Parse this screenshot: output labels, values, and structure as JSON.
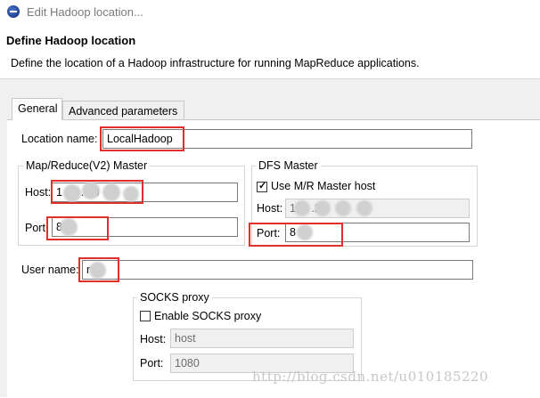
{
  "window": {
    "title": "Edit Hadoop location..."
  },
  "header": {
    "title": "Define Hadoop location",
    "description": "Define the location of a Hadoop infrastructure for running MapReduce applications."
  },
  "tabs": [
    {
      "label": "General",
      "selected": true
    },
    {
      "label": "Advanced parameters",
      "selected": false
    }
  ],
  "general": {
    "location_name_label": "Location name:",
    "location_name_value": "LocalHadoop",
    "mapreduce_group": {
      "label": "Map/Reduce(V2) Master",
      "host_label": "Host:",
      "host_value": "1 .... .. .0",
      "port_label": "Port:",
      "port_value": "8  0"
    },
    "dfs_group": {
      "label": "DFS Master",
      "use_mr_host_label": "Use M/R Master host",
      "use_mr_host_checked": true,
      "host_label": "Host:",
      "host_value": "1  .  .  .2",
      "port_label": "Port:",
      "port_value": "8  0"
    },
    "user_name_label": "User name:",
    "user_name_value": "r",
    "socks_group": {
      "label": "SOCKS proxy",
      "enable_label": "Enable SOCKS proxy",
      "enable_checked": false,
      "host_label": "Host:",
      "host_value": "host",
      "port_label": "Port:",
      "port_value": "1080"
    }
  },
  "watermark": "http://blog.csdn.net/u010185220",
  "colors": {
    "highlight_box": "#e0302a",
    "tab_border": "#c8c8c8",
    "panel_bg": "#f0f0f0"
  }
}
